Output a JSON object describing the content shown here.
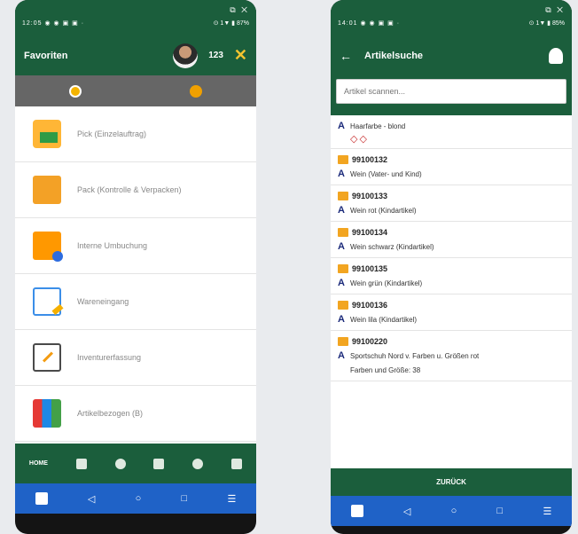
{
  "left": {
    "status": {
      "time": "12:05",
      "icons": "◉ ◉ ▣ ▣ ·",
      "right": "⊙ 1▼ ▮ 87%",
      "screenshot_buttons": "⧉ ✕"
    },
    "appbar": {
      "title": "Favoriten",
      "count": "123"
    },
    "menu": [
      {
        "icon": "pick-icon",
        "label": "Pick (Einzelauftrag)"
      },
      {
        "icon": "pack-icon",
        "label": "Pack (Kontrolle & Verpacken)"
      },
      {
        "icon": "transfer-icon",
        "label": "Interne Umbuchung"
      },
      {
        "icon": "receiving-icon",
        "label": "Wareneingang"
      },
      {
        "icon": "inventory-icon",
        "label": "Inventurerfassung"
      },
      {
        "icon": "grid-icon",
        "label": "Artikelbezogen (B)"
      }
    ],
    "bottom_nav": {
      "home": "HOME"
    }
  },
  "right": {
    "status": {
      "time": "14:01",
      "icons": "◉ ◉ ▣ ▣ ·",
      "right": "⊙ 1▼ ▮ 85%",
      "screenshot_buttons": "⧉ ✕"
    },
    "appbar": {
      "title": "Artikelsuche"
    },
    "search": {
      "placeholder": "Artikel scannen..."
    },
    "first_result": {
      "name": "Haarfarbe - blond",
      "warnings": "◇◇"
    },
    "results": [
      {
        "number": "99100132",
        "name": "Wein (Vater- und Kind)"
      },
      {
        "number": "99100133",
        "name": "Wein rot (Kindartikel)"
      },
      {
        "number": "99100134",
        "name": "Wein schwarz (Kindartikel)"
      },
      {
        "number": "99100135",
        "name": "Wein grün (Kindartikel)"
      },
      {
        "number": "99100136",
        "name": "Wein lila (Kindartikel)"
      },
      {
        "number": "99100220",
        "name": "Sportschuh Nord v. Farben u. Größen rot"
      }
    ],
    "cut_text": "Farben und Größe: 38",
    "footer": "ZURÜCK"
  },
  "sysnav": {
    "back": "◁",
    "home": "○",
    "recent": "□",
    "menu": "☰"
  }
}
